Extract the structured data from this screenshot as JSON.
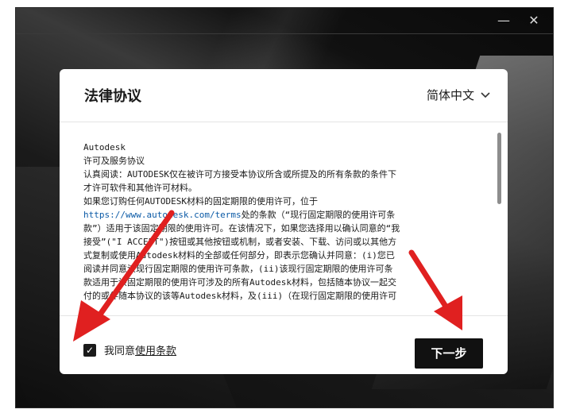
{
  "window": {
    "minimize_glyph": "—",
    "close_glyph": "✕"
  },
  "dialog": {
    "title": "法律协议",
    "language": "简体中文",
    "language_chevron": "⌄"
  },
  "agreement": {
    "lines": [
      "Autodesk",
      "许可及服务协议",
      "认真阅读：AUTODESK仅在被许可方接受本协议所含或所提及的所有条款的条件下",
      "才许可软件和其他许可材料。",
      "如果您订购任何AUTODESK材料的固定期限的使用许可，位于",
      "",
      "款”）适用于该固定期限的使用许可。在该情况下，如果您选择用以确认同意的“我",
      "接受”(\"I ACCEPT\")按钮或其他按钮或机制，或者安装、下载、访问或以其他方",
      "式复制或使用Autodesk材料的全部或任何部分，即表示您确认并同意：(i)您已",
      "阅读并同意该现行固定期限的使用许可条款，(ii)该现行固定期限的使用许可条",
      "款适用于该固定期限的使用许可涉及的所有Autodesk材料，包括随本协议一起交",
      "付的或伴随本协议的该等Autodesk材料，及(iii)（在现行固定期限的使用许可"
    ],
    "link_text": "https://www.autodesk.com/terms",
    "link_suffix": "处的条款（“现行固定期限的使用许可条"
  },
  "footer": {
    "agree_prefix": "我同意",
    "agree_link": "使用条款",
    "checkbox_glyph": "✓",
    "next_label": "下一步"
  },
  "colors": {
    "accent": "#111111",
    "arrow": "#e02020"
  }
}
